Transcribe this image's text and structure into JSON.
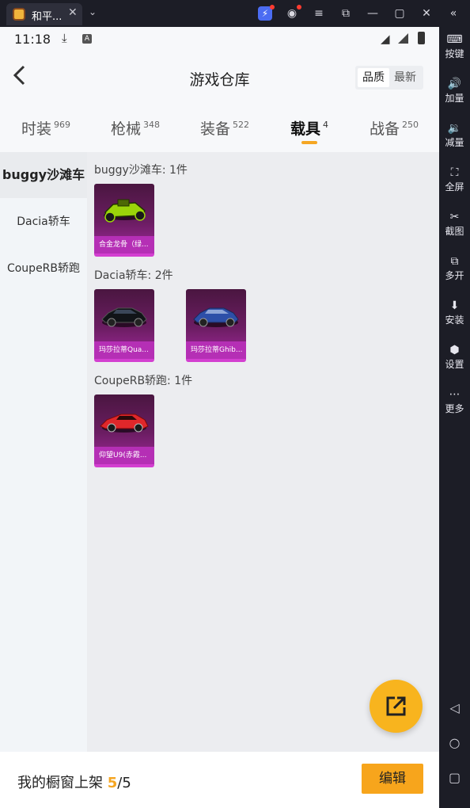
{
  "emulator": {
    "tab_title": "和平...",
    "close_glyph": "✕",
    "chevron_glyph": "⌄",
    "sidebar": [
      {
        "label": "按键",
        "icon": "keyboard-icon",
        "glyph": "⌨"
      },
      {
        "label": "加量",
        "icon": "volume-up-icon",
        "glyph": "🔊"
      },
      {
        "label": "减量",
        "icon": "volume-down-icon",
        "glyph": "🔉"
      },
      {
        "label": "全屏",
        "icon": "fullscreen-icon",
        "glyph": "⛶"
      },
      {
        "label": "截图",
        "icon": "scissors-icon",
        "glyph": "✂"
      },
      {
        "label": "多开",
        "icon": "multi-instance-icon",
        "glyph": "⧉"
      },
      {
        "label": "安装",
        "icon": "apk-install-icon",
        "glyph": "⬇"
      },
      {
        "label": "设置",
        "icon": "gear-icon",
        "glyph": "⬢"
      },
      {
        "label": "更多",
        "icon": "more-icon",
        "glyph": "⋯"
      }
    ],
    "nav": {
      "back_glyph": "◁",
      "home_glyph": "○",
      "recent_glyph": "▢"
    }
  },
  "statusbar": {
    "time": "11:18",
    "a_badge": "A"
  },
  "header": {
    "title": "游戏仓库",
    "sort_options": [
      "品质",
      "最新"
    ],
    "sort_selected": "品质"
  },
  "tabs": [
    {
      "label": "时装",
      "count": "969"
    },
    {
      "label": "枪械",
      "count": "348"
    },
    {
      "label": "装备",
      "count": "522"
    },
    {
      "label": "载具",
      "count": "4"
    },
    {
      "label": "战备",
      "count": "250"
    }
  ],
  "active_tab": "载具",
  "categories": [
    "buggy沙滩车",
    "Dacia轿车",
    "CoupeRB轿跑"
  ],
  "active_category": "buggy沙滩车",
  "groups": [
    {
      "title": "buggy沙滩车: 1件",
      "items": [
        {
          "name": "合金龙骨（绿...",
          "car_color": "#9bd40a"
        }
      ]
    },
    {
      "title": "Dacia轿车: 2件",
      "items": [
        {
          "name": "玛莎拉蒂Qua...",
          "car_color": "#111418"
        },
        {
          "name": "玛莎拉蒂Ghib...",
          "car_color": "#2d4fa8"
        }
      ]
    },
    {
      "title": "CoupeRB轿跑: 1件",
      "items": [
        {
          "name": "仰望U9(赤霞...",
          "car_color": "#e0272a"
        }
      ]
    }
  ],
  "footer": {
    "label": "我的橱窗上架",
    "count": "5",
    "total": "/5",
    "edit_label": "编辑"
  },
  "colors": {
    "accent": "#f5a623",
    "item_rarity": "#b52fb5"
  }
}
